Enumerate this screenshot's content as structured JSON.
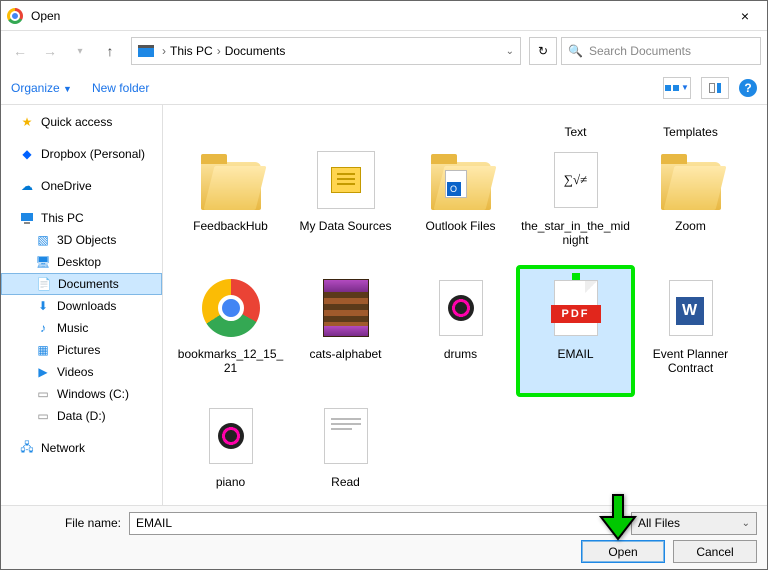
{
  "window": {
    "title": "Open",
    "close_label": "×"
  },
  "nav": {
    "back": "←",
    "forward": "→",
    "up": "↑",
    "breadcrumb": [
      "This PC",
      "Documents"
    ],
    "breadcrumb_sep": "›",
    "refresh": "↻",
    "search_placeholder": "Search Documents"
  },
  "toolbar": {
    "organize": "Organize",
    "new_folder": "New folder",
    "help": "?"
  },
  "sidebar": {
    "groups": [
      [
        {
          "icon": "star",
          "label": "Quick access"
        },
        {
          "icon": "dropbox",
          "label": "Dropbox (Personal)"
        },
        {
          "icon": "onedrive",
          "label": "OneDrive"
        }
      ],
      [
        {
          "icon": "pc",
          "label": "This PC"
        },
        {
          "icon": "3d",
          "label": "3D Objects",
          "sub": true
        },
        {
          "icon": "desktop",
          "label": "Desktop",
          "sub": true
        },
        {
          "icon": "documents",
          "label": "Documents",
          "sub": true,
          "selected": true
        },
        {
          "icon": "downloads",
          "label": "Downloads",
          "sub": true
        },
        {
          "icon": "music",
          "label": "Music",
          "sub": true
        },
        {
          "icon": "pictures",
          "label": "Pictures",
          "sub": true
        },
        {
          "icon": "videos",
          "label": "Videos",
          "sub": true
        },
        {
          "icon": "drive",
          "label": "Windows (C:)",
          "sub": true
        },
        {
          "icon": "drive",
          "label": "Data (D:)",
          "sub": true
        }
      ],
      [
        {
          "icon": "network",
          "label": "Network"
        }
      ]
    ]
  },
  "files": {
    "partial_row": [
      {
        "label": "Text"
      },
      {
        "label": "Templates"
      }
    ],
    "rows": [
      [
        {
          "kind": "folder",
          "label": "FeedbackHub"
        },
        {
          "kind": "folder-db",
          "label": "My Data Sources"
        },
        {
          "kind": "folder",
          "label": "Outlook Files"
        },
        {
          "kind": "file-txt",
          "label": "the_star_in_the_midnight"
        },
        {
          "kind": "folder",
          "label": "Zoom"
        }
      ],
      [
        {
          "kind": "chrome",
          "label": "bookmarks_12_15_21"
        },
        {
          "kind": "rar",
          "label": "cats-alphabet"
        },
        {
          "kind": "media",
          "label": "drums"
        },
        {
          "kind": "pdf",
          "label": "EMAIL",
          "selected": true
        },
        {
          "kind": "word",
          "label": "Event Planner Contract"
        }
      ],
      [
        {
          "kind": "media",
          "label": "piano"
        },
        {
          "kind": "txt",
          "label": "Read"
        }
      ]
    ]
  },
  "footer": {
    "file_name_label": "File name:",
    "file_name_value": "EMAIL",
    "type_filter": "All Files",
    "open": "Open",
    "cancel": "Cancel"
  },
  "icons": {
    "search": "🔍"
  }
}
